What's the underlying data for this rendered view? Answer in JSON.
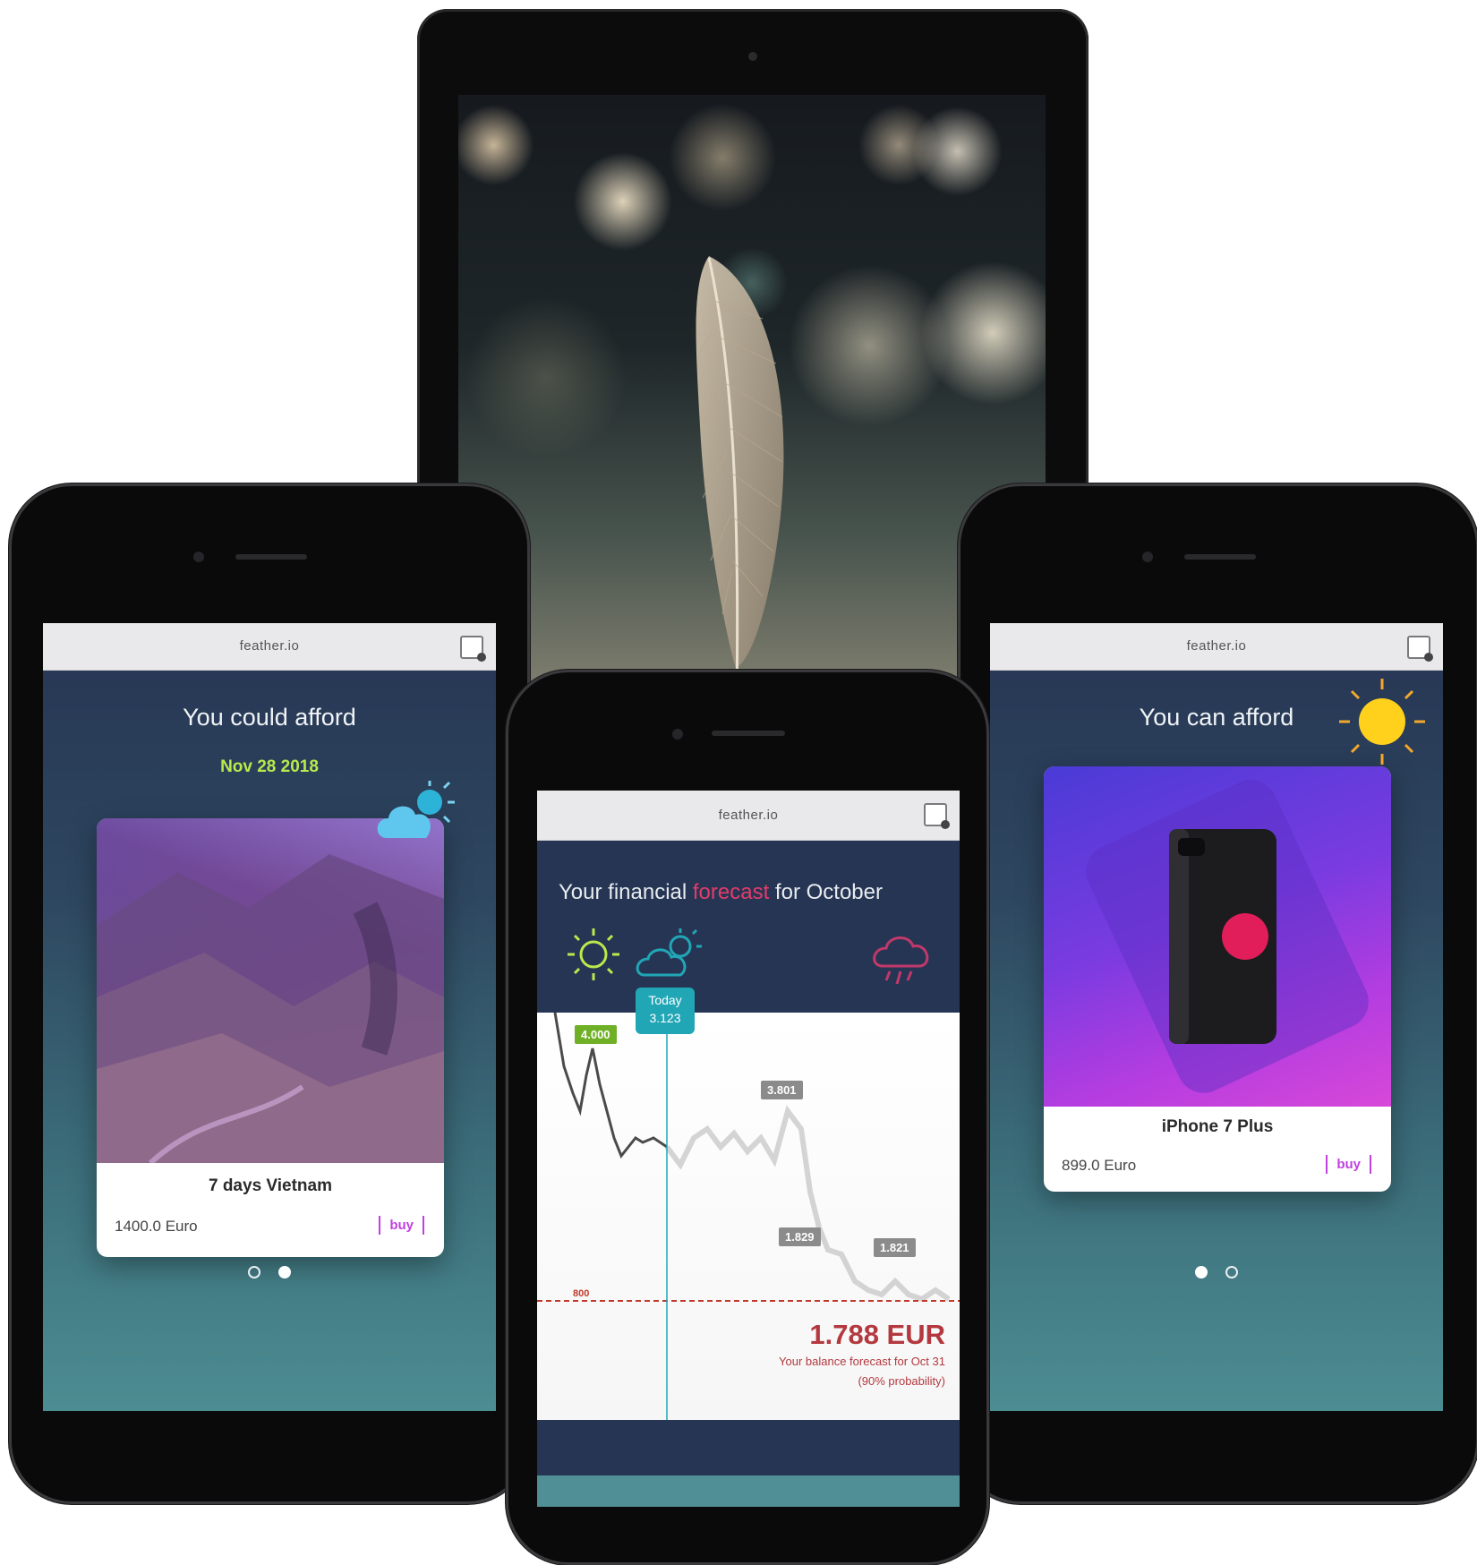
{
  "tablet": {
    "wallpaper_icon": "feather-wallpaper"
  },
  "left_phone": {
    "url": "feather.io",
    "headline": "You could afford",
    "date": "Nov 28 2018",
    "weather_icon": "cloud-sun-icon",
    "card": {
      "title": "7 days Vietnam",
      "price": "1400.0 Euro",
      "buy": "buy"
    },
    "page_dots": [
      "empty",
      "full"
    ]
  },
  "right_phone": {
    "url": "feather.io",
    "headline": "You can afford",
    "weather_icon": "sun-icon",
    "card": {
      "title": "iPhone 7 Plus",
      "price": "899.0 Euro",
      "buy": "buy"
    },
    "page_dots": [
      "full",
      "empty"
    ]
  },
  "center_phone": {
    "url": "feather.io",
    "headline_prefix": "Your financial ",
    "headline_highlight": "forecast",
    "headline_suffix": " for October",
    "weather_icons": [
      "sun-icon",
      "cloud-sun-icon",
      "rain-cloud-icon"
    ],
    "today_label": "Today",
    "today_value": "3.123",
    "tags": [
      "4.000",
      "3.801",
      "1.829",
      "1.821"
    ],
    "threshold_label": "800",
    "balance": "1.788 EUR",
    "balance_caption": "Your balance forecast for Oct 31",
    "balance_sub": "(90% probability)"
  },
  "colors": {
    "accent_pink": "#e23c6b",
    "buy_purple": "#c040e0",
    "date_green": "#b9e94c",
    "today_teal": "#21a6b6",
    "tag_green": "#6fb026",
    "tag_gray": "#8b8b8b",
    "balance_red": "#b3393f"
  }
}
